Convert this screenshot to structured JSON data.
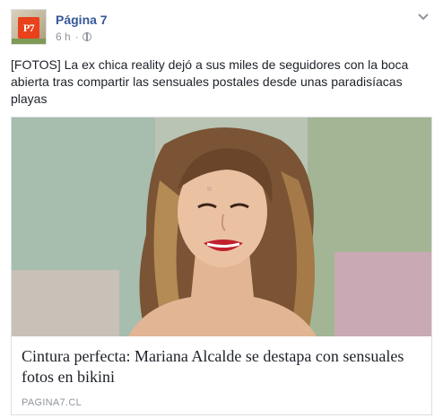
{
  "post": {
    "page_name": "Página 7",
    "avatar_logo_text": "P7",
    "timestamp": "6 h",
    "separator": "·",
    "privacy_icon": "globe-icon",
    "menu_icon": "chevron-down-icon",
    "text": "[FOTOS] La ex chica reality dejó a sus miles de seguidores con la boca abierta tras compartir las sensuales postales desde unas paradisíacas playas"
  },
  "link_card": {
    "image": "photo-of-woman-smiling",
    "title": "Cintura perfecta: Mariana Alcalde se destapa con sensuales fotos en bikini",
    "domain": "PAGINA7.CL"
  },
  "colors": {
    "link_blue": "#365899",
    "meta_gray": "#90949c",
    "text": "#1d2129",
    "border": "#dddfe2",
    "logo_orange": "#e8411c"
  }
}
